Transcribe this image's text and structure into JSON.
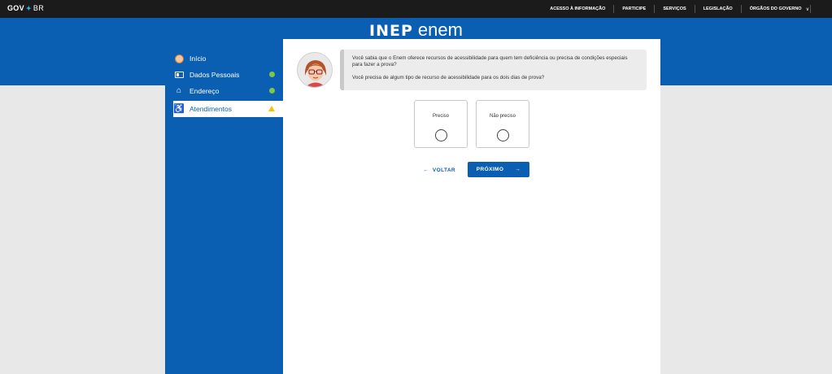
{
  "govbar": {
    "logo_gov": "GOV",
    "logo_br": "BR",
    "links": [
      "ACESSO À INFORMAÇÃO",
      "PARTICIPE",
      "SERVIÇOS",
      "LEGISLAÇÃO",
      "ÓRGÃOS DO GOVERNO"
    ]
  },
  "brand": {
    "inep": "INEP",
    "enem": "enem"
  },
  "sidebar": {
    "items": [
      {
        "label": "Início",
        "icon": "user-avatar-icon",
        "status": ""
      },
      {
        "label": "Dados Pessoais",
        "icon": "id-card-icon",
        "status": "ok"
      },
      {
        "label": "Endereço",
        "icon": "home-icon",
        "status": "ok"
      },
      {
        "label": "Atendimentos",
        "icon": "wheelchair-icon",
        "status": "warning",
        "active": true
      }
    ]
  },
  "message": {
    "line1": "Você sabia que o Enem oferece recursos de acessibilidade para quem tem deficiência ou precisa de condições especiais para fazer a prova?",
    "line2": "Você precisa de algum tipo de recurso de acessibilidade para os dois dias de prova?"
  },
  "options": [
    {
      "label": "Preciso",
      "selected": false
    },
    {
      "label": "Não preciso",
      "selected": false
    }
  ],
  "actions": {
    "back_label": "VOLTAR",
    "next_label": "PRÓXIMO"
  },
  "colors": {
    "primary": "#0b5fb3",
    "govbar": "#1b1b1b",
    "ok": "#7ec943",
    "warning": "#f5c400"
  }
}
